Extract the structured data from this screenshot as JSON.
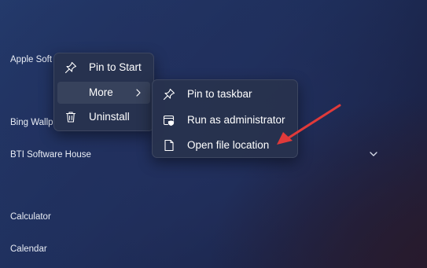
{
  "app_list": {
    "items": [
      "Apple Soft",
      "Bing Wallp",
      "BTI Software House",
      "Calculator",
      "Calendar"
    ]
  },
  "context_menu": {
    "items": [
      {
        "label": "Pin to Start",
        "icon": "pin-icon"
      },
      {
        "label": "More",
        "icon": "chevron-right-icon"
      },
      {
        "label": "Uninstall",
        "icon": "trash-icon"
      }
    ]
  },
  "submenu": {
    "items": [
      {
        "label": "Pin to taskbar",
        "icon": "pin-icon"
      },
      {
        "label": "Run as administrator",
        "icon": "admin-shield-icon"
      },
      {
        "label": "Open file location",
        "icon": "folder-file-icon"
      }
    ]
  },
  "colors": {
    "annotation_arrow": "#e03a3a",
    "menu_background": "#28324e"
  }
}
